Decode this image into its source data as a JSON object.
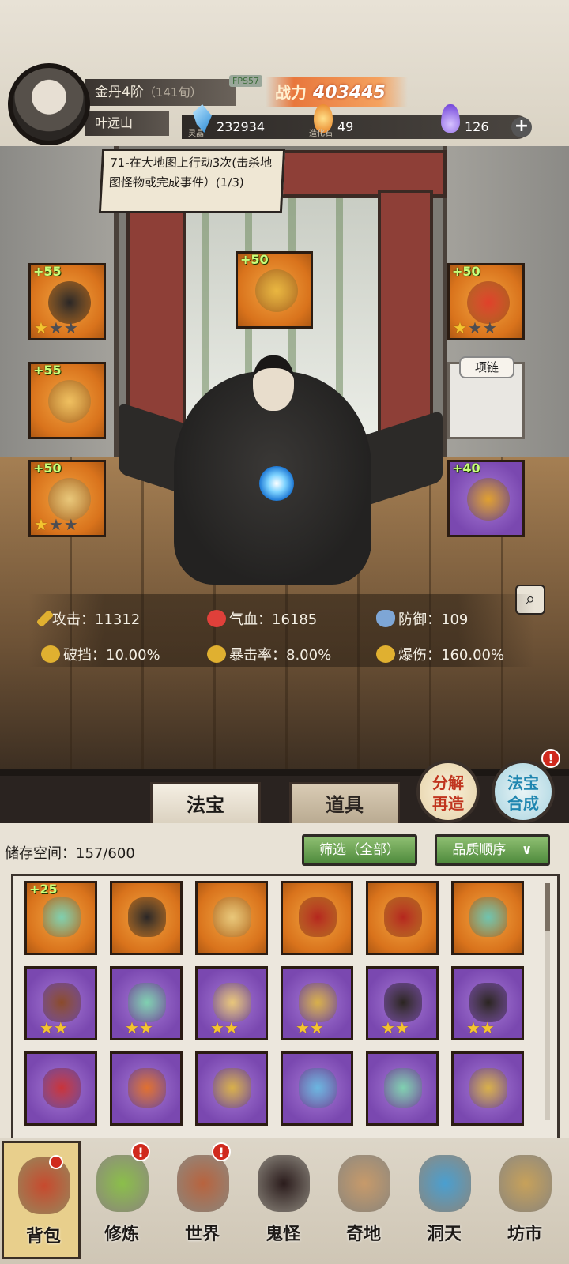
{
  "header": {
    "realm": "金丹4阶",
    "age": "（141旬）",
    "player_name": "叶远山",
    "fps": "FPS57",
    "power_label": "战力",
    "power_value": "403445"
  },
  "resources": [
    {
      "name": "灵晶",
      "value": "232934",
      "icon": "blue-crystal-icon"
    },
    {
      "name": "造化石",
      "value": "49",
      "icon": "orange-stone-icon"
    },
    {
      "name": "",
      "value": "126",
      "icon": "purple-flame-icon"
    }
  ],
  "quest": "71-在大地图上行动3次(击杀地图怪物或完成事件）(1/3)",
  "equipment": [
    {
      "level": "+55",
      "stars": 1,
      "max": 3,
      "rarity": "orange"
    },
    {
      "level": "+50",
      "stars": 0,
      "max": 0,
      "rarity": "orange"
    },
    {
      "level": "+50",
      "stars": 1,
      "max": 3,
      "rarity": "orange"
    },
    {
      "level": "+55",
      "stars": 0,
      "max": 0,
      "rarity": "orange"
    },
    {
      "level": "",
      "stars": 0,
      "max": 0,
      "rarity": "empty",
      "tag": "项链"
    },
    {
      "level": "+50",
      "stars": 1,
      "max": 3,
      "rarity": "orange"
    },
    {
      "level": "+40",
      "stars": 0,
      "max": 0,
      "rarity": "purple"
    }
  ],
  "stats": {
    "attack": "攻击：11312",
    "hp": "气血：16185",
    "defense": "防御：109",
    "break": "破挡：10.00%",
    "crit_rate": "暴击率：8.00%",
    "crit_dmg": "爆伤：160.00%"
  },
  "actions": {
    "decompose": [
      "分解",
      "再造"
    ],
    "synthesize": [
      "法宝",
      "合成"
    ],
    "badge": "!"
  },
  "tabs": {
    "active": "法宝",
    "other": "道具"
  },
  "inventory": {
    "storage": "储存空间：157/600",
    "filter": "筛选（全部）",
    "sort": "品质顺序",
    "sort_arrow": "∨",
    "items": [
      {
        "rarity": "orange",
        "level": "+25",
        "stars": 0,
        "color": "#7fd0b0"
      },
      {
        "rarity": "orange",
        "level": "",
        "stars": 0,
        "color": "#2a2626"
      },
      {
        "rarity": "orange",
        "level": "",
        "stars": 0,
        "color": "#e9c77a"
      },
      {
        "rarity": "orange",
        "level": "",
        "stars": 0,
        "color": "#b5261d"
      },
      {
        "rarity": "orange",
        "level": "",
        "stars": 0,
        "color": "#b5261d"
      },
      {
        "rarity": "orange",
        "level": "",
        "stars": 0,
        "color": "#6fc4b0"
      },
      {
        "rarity": "purple",
        "level": "",
        "stars": 2,
        "color": "#8a4a2a"
      },
      {
        "rarity": "purple",
        "level": "",
        "stars": 2,
        "color": "#7fd0b0"
      },
      {
        "rarity": "purple",
        "level": "",
        "stars": 2,
        "color": "#e9c77a"
      },
      {
        "rarity": "purple",
        "level": "",
        "stars": 2,
        "color": "#d8b04a"
      },
      {
        "rarity": "purple",
        "level": "",
        "stars": 2,
        "color": "#2a2420"
      },
      {
        "rarity": "purple",
        "level": "",
        "stars": 2,
        "color": "#2a2420"
      },
      {
        "rarity": "purple",
        "level": "",
        "stars": 0,
        "color": "#c9333a"
      },
      {
        "rarity": "purple",
        "level": "",
        "stars": 0,
        "color": "#e07030"
      },
      {
        "rarity": "purple",
        "level": "",
        "stars": 0,
        "color": "#d8b04a"
      },
      {
        "rarity": "purple",
        "level": "",
        "stars": 0,
        "color": "#6ab6e0"
      },
      {
        "rarity": "purple",
        "level": "",
        "stars": 0,
        "color": "#7fd0b0"
      },
      {
        "rarity": "purple",
        "level": "",
        "stars": 0,
        "color": "#d8b04a"
      }
    ]
  },
  "nav": [
    {
      "label": "背包",
      "icon": "backpack-icon",
      "color": "#c74a2e",
      "badge": false
    },
    {
      "label": "修炼",
      "icon": "lotus-icon",
      "color": "#8bbf4a",
      "badge": true
    },
    {
      "label": "世界",
      "icon": "scroll-map-icon",
      "color": "#b8633e",
      "badge": true
    },
    {
      "label": "鬼怪",
      "icon": "demon-egg-icon",
      "color": "#2b1c1c",
      "badge": false
    },
    {
      "label": "奇地",
      "icon": "floating-island-icon",
      "color": "#c79a6a",
      "badge": false
    },
    {
      "label": "洞天",
      "icon": "portal-icon",
      "color": "#4a9fd0",
      "badge": false
    },
    {
      "label": "坊市",
      "icon": "market-stall-icon",
      "color": "#c7a15a",
      "badge": false
    }
  ]
}
